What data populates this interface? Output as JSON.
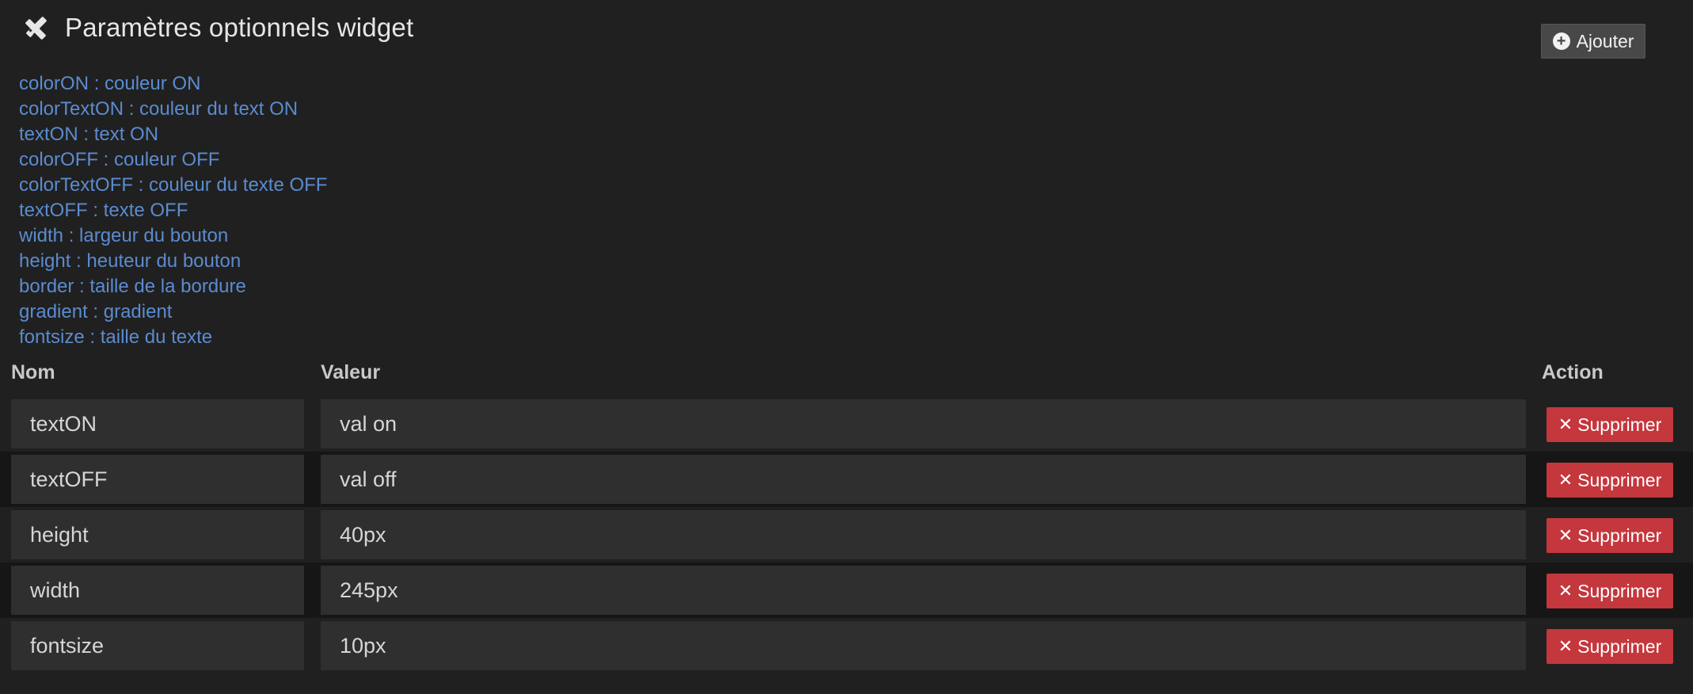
{
  "header": {
    "title": "Paramètres optionnels widget",
    "icon": "pencil-ruler-icon"
  },
  "toolbar": {
    "add_label": "Ajouter",
    "add_icon": "plus-circle-icon"
  },
  "help_lines": [
    "colorON : couleur ON",
    "colorTextON : couleur du text ON",
    "textON : text ON",
    "colorOFF : couleur OFF",
    "colorTextOFF : couleur du texte OFF",
    "textOFF : texte OFF",
    "width : largeur du bouton",
    "height : heuteur du bouton",
    "border : taille de la bordure",
    "gradient : gradient",
    "fontsize : taille du texte"
  ],
  "table": {
    "headers": {
      "name": "Nom",
      "value": "Valeur",
      "action": "Action"
    },
    "delete_label": "Supprimer",
    "delete_icon": "close-icon",
    "rows": [
      {
        "name": "textON",
        "value": "val on"
      },
      {
        "name": "textOFF",
        "value": "val off"
      },
      {
        "name": "height",
        "value": "40px"
      },
      {
        "name": "width",
        "value": "245px"
      },
      {
        "name": "fontsize",
        "value": "10px"
      }
    ]
  },
  "colors": {
    "background": "#202020",
    "help_text": "#5b8bd0",
    "delete_button": "#c4373d",
    "add_button": "#484848",
    "field": "#2f2f2f"
  }
}
